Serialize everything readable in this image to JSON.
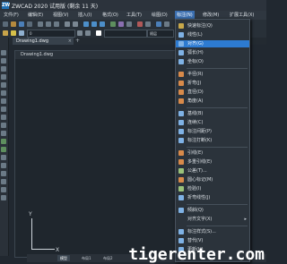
{
  "titlebar": {
    "app_icon": "ZW",
    "title": "ZWCAD 2020 试用版 (剩余 11 天)"
  },
  "menubar": {
    "items": [
      {
        "label": "文件(F)"
      },
      {
        "label": "编辑(E)"
      },
      {
        "label": "视图(V)"
      },
      {
        "label": "插入(I)"
      },
      {
        "label": "格式(O)"
      },
      {
        "label": "工具(T)"
      },
      {
        "label": "绘图(D)"
      },
      {
        "label": "标注(N)"
      },
      {
        "label": "修改(M)"
      },
      {
        "label": "扩展工具(X)"
      }
    ],
    "active_index": 7
  },
  "toolbar": {
    "layer_select": "0",
    "dim_select": "随层"
  },
  "document": {
    "tab_label": "Drawing1.dwg",
    "tab_close": "×",
    "tab_add": "+",
    "window_title": "Drawing1.dwg"
  },
  "ucs": {
    "y_label": "Y",
    "x_label": "X"
  },
  "layout_tabs": [
    {
      "label": "模型"
    },
    {
      "label": "布局1"
    },
    {
      "label": "布局2"
    }
  ],
  "dropdown": {
    "items": [
      {
        "label": "快速标注(Q)",
        "icon_color": "#c8a84a"
      },
      {
        "label": "线性(L)",
        "icon_color": "#7fb2e5"
      },
      {
        "label": "对齐(G)",
        "icon_color": "#7fb2e5",
        "highlight": true
      },
      {
        "label": "弧长(H)",
        "icon_color": "#7fb2e5"
      },
      {
        "label": "坐标(O)",
        "icon_color": "#7fb2e5"
      },
      {
        "label": "半径(R)",
        "icon_color": "#d88a4a"
      },
      {
        "label": "折弯(J)",
        "icon_color": "#d88a4a"
      },
      {
        "label": "直径(D)",
        "icon_color": "#d88a4a"
      },
      {
        "label": "角度(A)",
        "icon_color": "#d88a4a"
      },
      {
        "label": "基线(B)",
        "icon_color": "#7fb2e5"
      },
      {
        "label": "连续(C)",
        "icon_color": "#7fb2e5"
      },
      {
        "label": "标注间距(P)",
        "icon_color": "#7fb2e5"
      },
      {
        "label": "标注打断(K)",
        "icon_color": "#7fb2e5"
      },
      {
        "label": "引线(E)",
        "icon_color": "#d88a4a"
      },
      {
        "label": "多重引线(E)",
        "icon_color": "#d88a4a"
      },
      {
        "label": "公差(T)...",
        "icon_color": "#9ac27a"
      },
      {
        "label": "圆心标记(M)",
        "icon_color": "#d88a4a"
      },
      {
        "label": "检验(I)",
        "icon_color": "#9ac27a"
      },
      {
        "label": "折弯线性(J)",
        "icon_color": "#7fb2e5"
      },
      {
        "label": "倾斜(Q)",
        "icon_color": "#7fb2e5"
      },
      {
        "label": "对齐文字(X)",
        "icon_color": "",
        "submenu": true
      },
      {
        "label": "标注样式(S)...",
        "icon_color": "#7fb2e5"
      },
      {
        "label": "替代(V)",
        "icon_color": "#7fb2e5"
      },
      {
        "label": "更新(U)",
        "icon_color": "#7fb2e5"
      }
    ],
    "submenu_arrow": "▸"
  },
  "watermark": "tigerenter.com"
}
